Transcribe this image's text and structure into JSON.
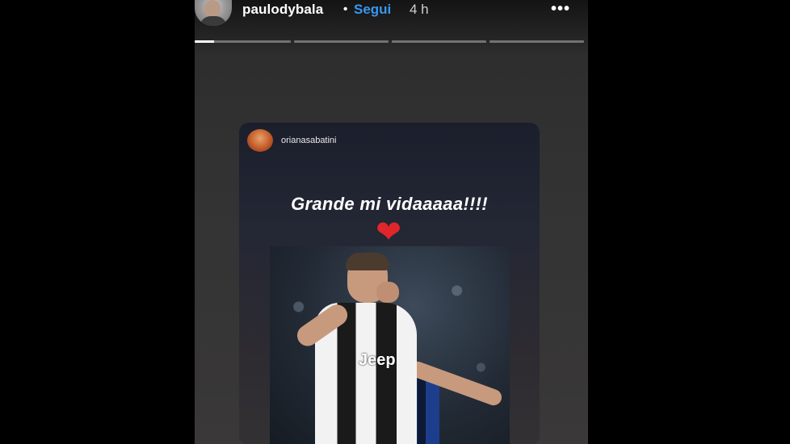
{
  "story": {
    "username": "paulodybala",
    "separator": "•",
    "follow_label": "Segui",
    "time_ago": "4 h",
    "more_label": "•••",
    "progress_segments": [
      {
        "fill": 0.2
      },
      {
        "fill": 0.0
      },
      {
        "fill": 0.0
      },
      {
        "fill": 0.0
      }
    ]
  },
  "shared_post": {
    "username": "orianasabatini",
    "caption": "Grande mi vidaaaaa!!!!",
    "heart": "❤",
    "photo_text": "Jeep"
  },
  "colors": {
    "background": "#000000",
    "follow": "#3897f0",
    "heart": "#e0262b"
  },
  "icons": [
    "avatar",
    "more-options-icon",
    "heart-icon"
  ]
}
